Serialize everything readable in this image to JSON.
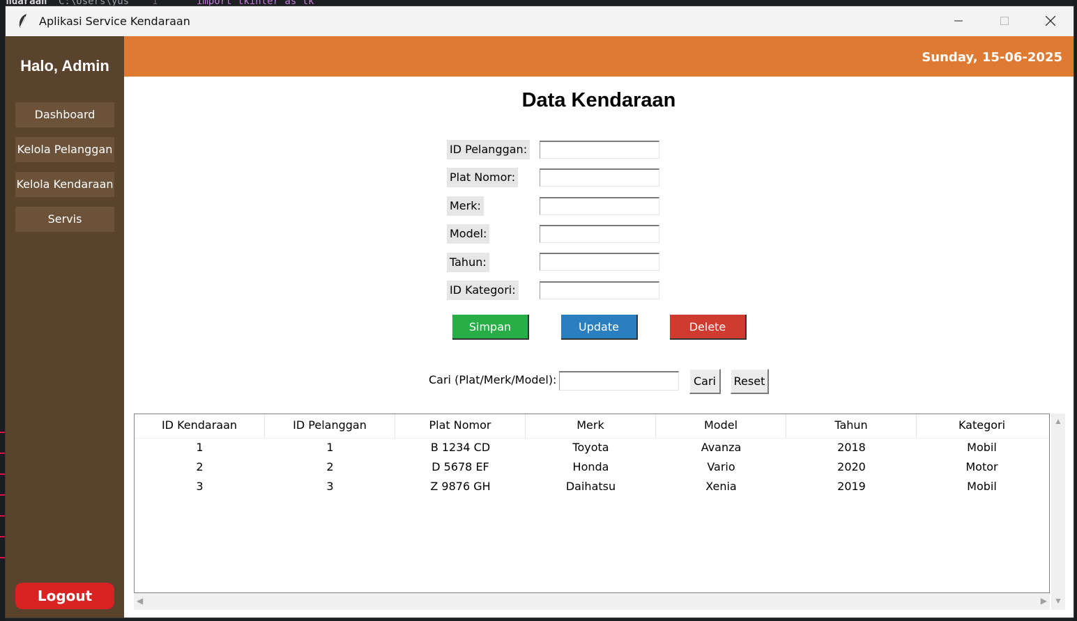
{
  "window": {
    "title": "Aplikasi Service Kendaraan"
  },
  "sidebar": {
    "greeting": "Halo, Admin",
    "items": [
      {
        "label": "Dashboard"
      },
      {
        "label": "Kelola Pelanggan"
      },
      {
        "label": "Kelola Kendaraan"
      },
      {
        "label": "Servis"
      }
    ],
    "logout_label": "Logout"
  },
  "header": {
    "date": "Sunday, 15-06-2025"
  },
  "main": {
    "title": "Data Kendaraan",
    "form": {
      "fields": [
        {
          "label": "ID Pelanggan:",
          "value": ""
        },
        {
          "label": "Plat Nomor:",
          "value": ""
        },
        {
          "label": "Merk:",
          "value": ""
        },
        {
          "label": "Model:",
          "value": ""
        },
        {
          "label": "Tahun:",
          "value": ""
        },
        {
          "label": "ID Kategori:",
          "value": ""
        }
      ],
      "buttons": {
        "save": "Simpan",
        "update": "Update",
        "delete": "Delete"
      }
    },
    "search": {
      "label": "Cari (Plat/Merk/Model):",
      "value": "",
      "search_button": "Cari",
      "reset_button": "Reset"
    },
    "table": {
      "columns": [
        "ID Kendaraan",
        "ID Pelanggan",
        "Plat Nomor",
        "Merk",
        "Model",
        "Tahun",
        "Kategori"
      ],
      "rows": [
        [
          "1",
          "1",
          "B 1234 CD",
          "Toyota",
          "Avanza",
          "2018",
          "Mobil"
        ],
        [
          "2",
          "2",
          "D 5678 EF",
          "Honda",
          "Vario",
          "2020",
          "Motor"
        ],
        [
          "3",
          "3",
          "Z 9876 GH",
          "Daihatsu",
          "Xenia",
          "2019",
          "Mobil"
        ]
      ]
    }
  },
  "colors": {
    "sidebar": "#5a432c",
    "sidebar_button": "#6b5239",
    "header": "#df7a33",
    "save": "#27ae47",
    "update": "#2a7fc1",
    "delete": "#cf3b2f",
    "logout": "#d92222"
  },
  "background_editor": {
    "filename": "endaraan",
    "path": "C:\\Users\\yus",
    "line_number": "1",
    "code": "import tkinter as tk"
  }
}
